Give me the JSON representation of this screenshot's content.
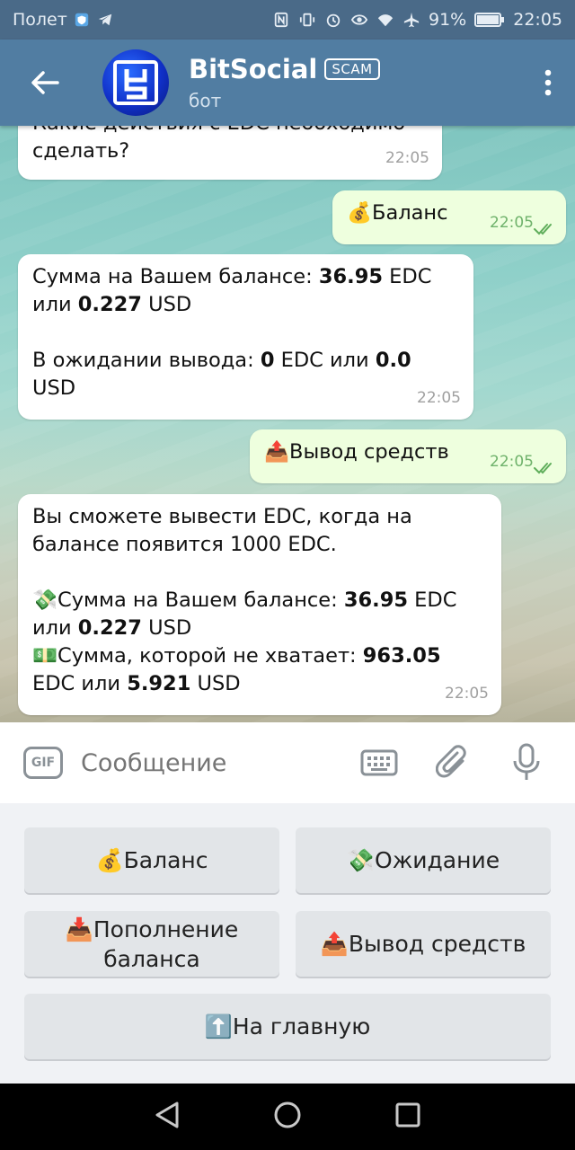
{
  "status_bar": {
    "carrier": "Полет",
    "battery": "91%",
    "time": "22:05"
  },
  "header": {
    "title": "BitSocial",
    "badge": "SCAM",
    "subtitle": "бот"
  },
  "messages": [
    {
      "direction": "in",
      "text": "Какие действия с EDC необходимо сделать?",
      "time": "22:05"
    },
    {
      "direction": "out",
      "emoji": "💰",
      "text": "Баланс",
      "time": "22:05",
      "read": true
    },
    {
      "direction": "in",
      "time": "22:05",
      "line1_prefix": "Сумма на Вашем балансе: ",
      "line1_value": "36.95",
      "line1_unit": " EDC",
      "line2_prefix": "или ",
      "line2_value": "0.227",
      "line2_unit": " USD",
      "line3_prefix": "В ожидании вывода: ",
      "line3_value": "0",
      "line3_mid": " EDC  или ",
      "line3_value2": "0.0",
      "line3_unit": "USD"
    },
    {
      "direction": "out",
      "emoji": "📤",
      "text": "Вывод средств",
      "time": "22:05",
      "read": true
    },
    {
      "direction": "in",
      "time": "22:05",
      "intro": "Вы сможете вывести EDC, когда на балансе появится 1000 EDC.",
      "bal_emoji": "💸",
      "bal_prefix": "Сумма на Вашем балансе: ",
      "bal_value": "36.95",
      "bal_unit": " EDC",
      "bal_usd_prefix": "или ",
      "bal_usd_value": "0.227",
      "bal_usd_unit": " USD",
      "miss_emoji": "💵",
      "miss_prefix": "Сумма, которой не хватает: ",
      "miss_value": "963.05",
      "miss_edc": "EDC  или ",
      "miss_usd_value": "5.921",
      "miss_usd_unit": " USD"
    }
  ],
  "input": {
    "placeholder": "Сообщение",
    "gif_label": "GIF"
  },
  "keyboard": {
    "balance": {
      "emoji": "💰",
      "label": "Баланс"
    },
    "pending": {
      "emoji": "💸",
      "label": "Ожидание"
    },
    "deposit": {
      "emoji": "📥",
      "label_line1": "Пополнение",
      "label_line2": "баланса"
    },
    "withdraw": {
      "emoji": "📤",
      "label": "Вывод средств"
    },
    "home": {
      "emoji": "⬆️",
      "label": "На главную"
    }
  },
  "colors": {
    "header": "#517da2",
    "incoming_bubble": "#ffffff",
    "outgoing_bubble": "#eeffde",
    "read_check": "#5fae5b"
  }
}
